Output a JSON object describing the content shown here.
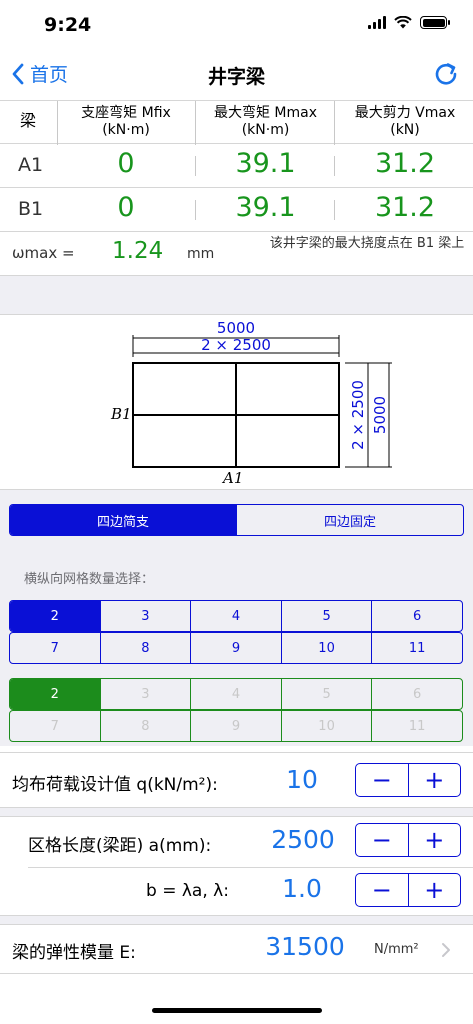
{
  "status": {
    "time": "9:24"
  },
  "nav": {
    "back_label": "首页",
    "title": "井字梁"
  },
  "table": {
    "headers": [
      {
        "line1": "梁",
        "line2": ""
      },
      {
        "line1": "支座弯矩 Mfix",
        "line2": "(kN·m)"
      },
      {
        "line1": "最大弯矩 Mmax",
        "line2": "(kN·m)"
      },
      {
        "line1": "最大剪力 Vmax",
        "line2": "(kN)"
      }
    ],
    "rows": [
      {
        "label": "A1",
        "values": [
          "0",
          "39.1",
          "31.2"
        ]
      },
      {
        "label": "B1",
        "values": [
          "0",
          "39.1",
          "31.2"
        ]
      }
    ],
    "deflection": {
      "label": "ωmax =",
      "value": "1.24",
      "unit": "mm",
      "note": "该井字梁的最大挠度点在 B1 梁上"
    }
  },
  "diagram": {
    "top_dim_total": "5000",
    "top_dim_split": "2 × 2500",
    "right_dim_split": "2 × 2500",
    "right_dim_total": "5000",
    "label_b": "B1",
    "label_a": "A1"
  },
  "support": {
    "options": [
      "四边简支",
      "四边固定"
    ],
    "selected": 0
  },
  "grid": {
    "label": "横纵向网格数量选择：",
    "blue_row1": [
      "2",
      "3",
      "4",
      "5",
      "6"
    ],
    "blue_row2": [
      "7",
      "8",
      "9",
      "10",
      "11"
    ],
    "green_row1": [
      "2",
      "3",
      "4",
      "5",
      "6"
    ],
    "green_row2": [
      "7",
      "8",
      "9",
      "10",
      "11"
    ],
    "blue_selected": "2",
    "green_selected": "2"
  },
  "params": {
    "load": {
      "label": "均布荷载设计值  q(kN/m²):",
      "value": "10"
    },
    "length": {
      "label": "区格长度(梁距)  a(mm):",
      "value": "2500"
    },
    "ratio": {
      "label": "b = λa,   λ:",
      "value": "1.0"
    },
    "modulus": {
      "label": "梁的弹性模量  E:",
      "value": "31500",
      "unit": "N/mm²"
    },
    "minus": "−",
    "plus": "+"
  },
  "colors": {
    "blue": "#0a10d6",
    "green": "#18951d",
    "link": "#1a73e8"
  }
}
